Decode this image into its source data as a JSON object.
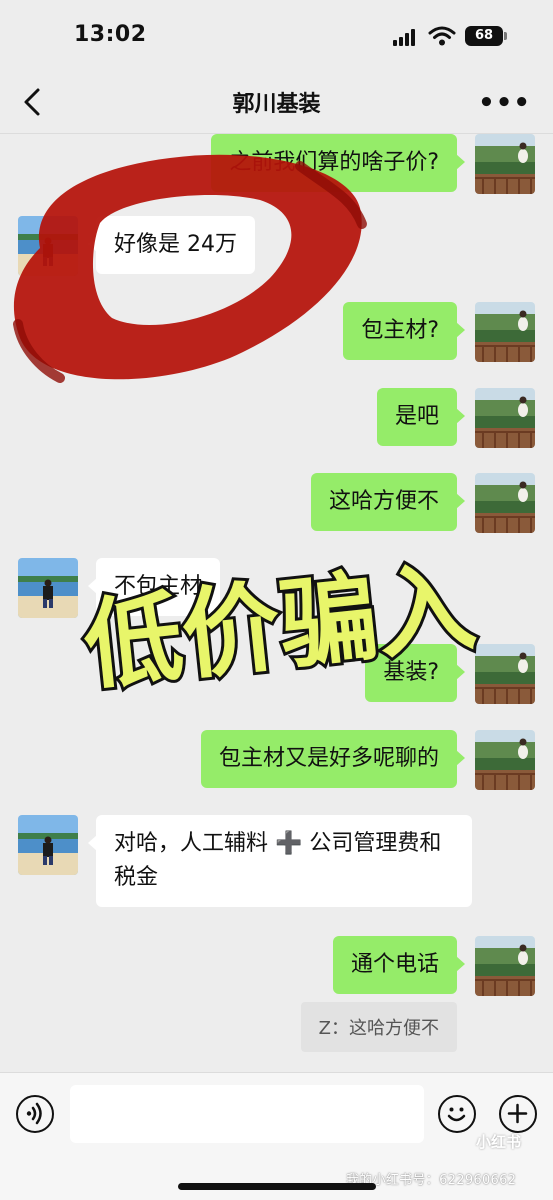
{
  "status_bar": {
    "time": "13:02",
    "battery": "68"
  },
  "header": {
    "title": "郭川基装"
  },
  "messages": [
    {
      "side": "right",
      "text": "之前我们算的啥子价?"
    },
    {
      "side": "left",
      "text": "好像是 24万"
    },
    {
      "side": "right",
      "text": "包主材?"
    },
    {
      "side": "right",
      "text": "是吧"
    },
    {
      "side": "right",
      "text": "这哈方便不"
    },
    {
      "side": "left",
      "text": "不包主材"
    },
    {
      "side": "right",
      "text": "基装?"
    },
    {
      "side": "right",
      "text": "包主材又是好多呢聊的"
    },
    {
      "side": "left",
      "text": "对哈，人工辅料 ➕ 公司管理费和税金"
    },
    {
      "side": "right",
      "text": "通个电话"
    }
  ],
  "quoted_reply": "Z：这哈方便不",
  "overlay": {
    "banner_text": "低价骗入"
  },
  "watermark": {
    "logo": "小红书",
    "id_text": "我的小红书号：622960662"
  },
  "icons": [
    "back-icon",
    "more-icon",
    "voice-icon",
    "emoji-icon",
    "plus-icon"
  ],
  "colors": {
    "sent_bubble": "#95ec69",
    "received_bubble": "#ffffff",
    "background": "#ededed",
    "scribble": "#b5120a",
    "banner_fill": "#e8f56a"
  }
}
